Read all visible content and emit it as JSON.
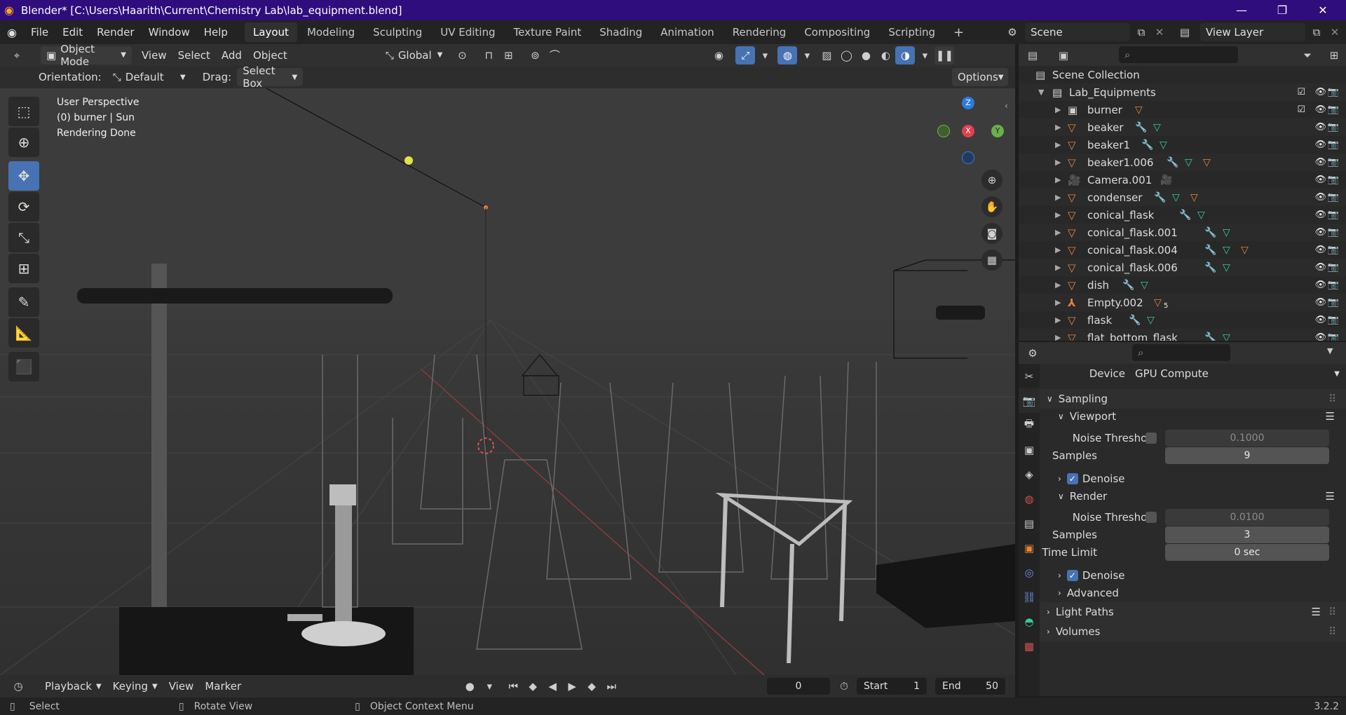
{
  "window": {
    "title": "Blender* [C:\\Users\\Haarith\\Current\\Chemistry Lab\\lab_equipment.blend]"
  },
  "menu": [
    "File",
    "Edit",
    "Render",
    "Window",
    "Help"
  ],
  "workspaces": [
    "Layout",
    "Modeling",
    "Sculpting",
    "UV Editing",
    "Texture Paint",
    "Shading",
    "Animation",
    "Rendering",
    "Compositing",
    "Scripting"
  ],
  "scene": {
    "name": "Scene",
    "view_layer": "View Layer"
  },
  "vp_header": {
    "mode": "Object Mode",
    "menus": [
      "View",
      "Select",
      "Add",
      "Object"
    ],
    "transform": "Global"
  },
  "tool_settings": {
    "orientation_label": "Orientation:",
    "orientation": "Default",
    "drag_label": "Drag:",
    "drag": "Select Box",
    "options": "Options"
  },
  "viewport": {
    "line1": "User Perspective",
    "line2": "(0) burner | Sun",
    "line3": "Rendering Done",
    "gizmo": {
      "z": "Z",
      "x": "X",
      "y": "Y"
    }
  },
  "outliner": {
    "root": "Scene Collection",
    "collection": "Lab_Equipments",
    "items": [
      "burner",
      "beaker",
      "beaker1",
      "beaker1.006",
      "Camera.001",
      "condenser",
      "conical_flask",
      "conical_flask.001",
      "conical_flask.004",
      "conical_flask.006",
      "dish",
      "Empty.002",
      "flask",
      "flat_bottom_flask"
    ],
    "empty_child_count": "5"
  },
  "properties": {
    "device_label": "Device",
    "device": "GPU Compute",
    "sampling": "Sampling",
    "viewport": "Viewport",
    "noise_threshold_label": "Noise Threshold",
    "viewport_noise": "0.1000",
    "samples_label": "Samples",
    "viewport_samples": "9",
    "denoise": "Denoise",
    "render": "Render",
    "render_noise": "0.0100",
    "render_samples": "3",
    "time_limit_label": "Time Limit",
    "time_limit": "0 sec",
    "advanced": "Advanced",
    "light_paths": "Light Paths",
    "volumes": "Volumes"
  },
  "timeline": {
    "menus": [
      "Playback",
      "Keying",
      "View",
      "Marker"
    ],
    "current_frame": "0",
    "start_label": "Start",
    "start": "1",
    "end_label": "End",
    "end": "50"
  },
  "status": {
    "select": "Select",
    "rotate": "Rotate View",
    "context": "Object Context Menu",
    "version": "3.2.2"
  },
  "colors": {
    "title_bar": "#2f0d7d",
    "accent": "#4772b3",
    "mesh_icon": "#e8833a",
    "modifier_icon": "#6b8ee6",
    "data_icon": "#38c9a0"
  }
}
